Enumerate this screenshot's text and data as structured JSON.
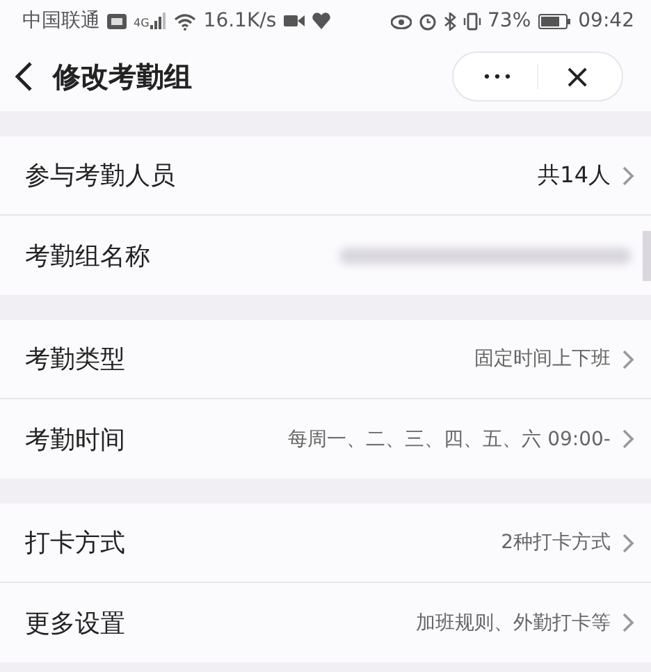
{
  "status_bar": {
    "carrier": "中国联通",
    "network": "4G",
    "speed": "16.1K/s",
    "battery_percent": "73%",
    "time": "09:42"
  },
  "nav_bar": {
    "title": "修改考勤组",
    "more_label": "•••",
    "close_label": "×"
  },
  "groups": [
    {
      "rows": [
        {
          "label": "参与考勤人员",
          "value": "共14人",
          "emphasized": true
        },
        {
          "label": "考勤组名称",
          "value_redacted": true
        }
      ]
    },
    {
      "rows": [
        {
          "label": "考勤类型",
          "value": "固定时间上下班",
          "emphasized": false
        },
        {
          "label": "考勤时间",
          "value": "每周一、二、三、四、五、六 09:00-",
          "emphasized": false
        }
      ]
    },
    {
      "rows": [
        {
          "label": "打卡方式",
          "value": "2种打卡方式",
          "emphasized": false
        },
        {
          "label": "更多设置",
          "value": "加班规则、外勤打卡等",
          "emphasized": false
        }
      ]
    }
  ]
}
